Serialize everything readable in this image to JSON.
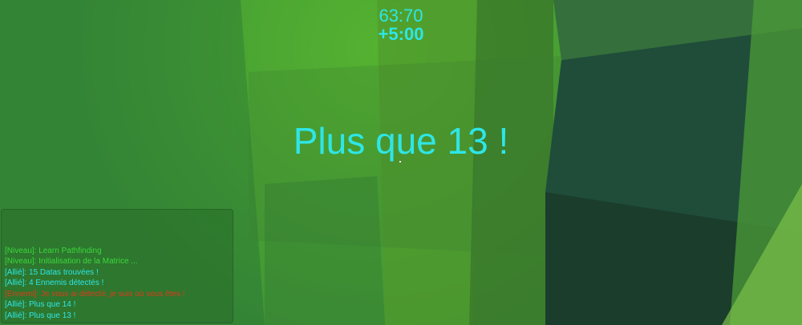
{
  "hud": {
    "timer": "63:70",
    "bonus": "+5:00"
  },
  "center_message": "Plus que 13 !",
  "chat": {
    "lines": [
      {
        "text": "[Niveau]: Learn Pathfinding",
        "color": "#3bd83b"
      },
      {
        "text": "[Niveau]: Initialisation de la Matrice ...",
        "color": "#3bd83b"
      },
      {
        "text": "[Allié]: 15 Datas trouvées !",
        "color": "#2ee6e6"
      },
      {
        "text": "[Allié]: 4 Ennemis détectés !",
        "color": "#2ee6e6"
      },
      {
        "text": "[Ennemi]: Je vous ai détecté, je suis où vous êtes !",
        "color": "#e03a1a"
      },
      {
        "text": "[Allié]: Plus que 14 !",
        "color": "#2ee6e6"
      },
      {
        "text": "[Allié]: Plus que 13 !",
        "color": "#2ee6e6"
      }
    ]
  },
  "colors": {
    "hud_text": "#2ee6e6",
    "level_text": "#3bd83b",
    "enemy_text": "#e03a1a",
    "ally_text": "#2ee6e6"
  }
}
